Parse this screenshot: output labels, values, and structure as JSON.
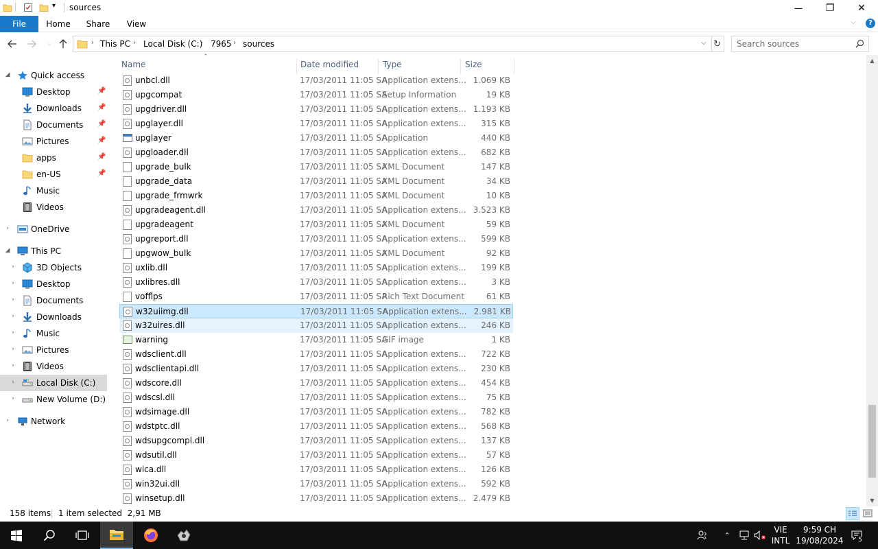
{
  "window": {
    "title": "sources",
    "controls": {
      "minimize": "—",
      "maximize": "❐",
      "close": "✕"
    }
  },
  "ribbon": {
    "tabs": [
      "File",
      "Home",
      "Share",
      "View"
    ]
  },
  "address": {
    "breadcrumbs": [
      "This PC",
      "Local Disk (C:)",
      "7965",
      "sources"
    ],
    "search_placeholder": "Search sources"
  },
  "nav_pane": {
    "quick_access": {
      "label": "Quick access",
      "items": [
        {
          "label": "Desktop",
          "icon": "desktop-icon",
          "pinned": true
        },
        {
          "label": "Downloads",
          "icon": "downloads-icon",
          "pinned": true
        },
        {
          "label": "Documents",
          "icon": "documents-icon",
          "pinned": true
        },
        {
          "label": "Pictures",
          "icon": "pictures-icon",
          "pinned": true
        },
        {
          "label": "apps",
          "icon": "folder-icon",
          "pinned": true
        },
        {
          "label": "en-US",
          "icon": "folder-icon",
          "pinned": true
        },
        {
          "label": "Music",
          "icon": "music-icon",
          "pinned": false
        },
        {
          "label": "Videos",
          "icon": "videos-icon",
          "pinned": false
        }
      ]
    },
    "onedrive": "OneDrive",
    "this_pc": {
      "label": "This PC",
      "items": [
        {
          "label": "3D Objects",
          "icon": "3d-objects-icon"
        },
        {
          "label": "Desktop",
          "icon": "desktop-icon"
        },
        {
          "label": "Documents",
          "icon": "documents-icon"
        },
        {
          "label": "Downloads",
          "icon": "downloads-icon"
        },
        {
          "label": "Music",
          "icon": "music-icon"
        },
        {
          "label": "Pictures",
          "icon": "pictures-icon"
        },
        {
          "label": "Videos",
          "icon": "videos-icon"
        },
        {
          "label": "Local Disk (C:)",
          "icon": "local-disk-icon",
          "selected": true
        },
        {
          "label": "New Volume (D:)",
          "icon": "drive-icon"
        }
      ]
    },
    "network": "Network"
  },
  "file_list": {
    "columns": [
      "Name",
      "Date modified",
      "Type",
      "Size"
    ],
    "rows": [
      {
        "name": "unbcl.dll",
        "date": "17/03/2011 11:05 SA",
        "type": "Application extens...",
        "size": "1.069 KB",
        "icon": "dll"
      },
      {
        "name": "upgcompat",
        "date": "17/03/2011 11:05 SA",
        "type": "Setup Information",
        "size": "19 KB",
        "icon": "inf"
      },
      {
        "name": "upgdriver.dll",
        "date": "17/03/2011 11:05 SA",
        "type": "Application extens...",
        "size": "1.193 KB",
        "icon": "dll"
      },
      {
        "name": "upglayer.dll",
        "date": "17/03/2011 11:05 SA",
        "type": "Application extens...",
        "size": "315 KB",
        "icon": "dll"
      },
      {
        "name": "upglayer",
        "date": "17/03/2011 11:05 SA",
        "type": "Application",
        "size": "440 KB",
        "icon": "app"
      },
      {
        "name": "upgloader.dll",
        "date": "17/03/2011 11:05 SA",
        "type": "Application extens...",
        "size": "682 KB",
        "icon": "dll"
      },
      {
        "name": "upgrade_bulk",
        "date": "17/03/2011 11:05 SA",
        "type": "XML Document",
        "size": "147 KB",
        "icon": "xml"
      },
      {
        "name": "upgrade_data",
        "date": "17/03/2011 11:05 SA",
        "type": "XML Document",
        "size": "34 KB",
        "icon": "xml"
      },
      {
        "name": "upgrade_frmwrk",
        "date": "17/03/2011 11:05 SA",
        "type": "XML Document",
        "size": "10 KB",
        "icon": "xml"
      },
      {
        "name": "upgradeagent.dll",
        "date": "17/03/2011 11:05 SA",
        "type": "Application extens...",
        "size": "3.523 KB",
        "icon": "dll"
      },
      {
        "name": "upgradeagent",
        "date": "17/03/2011 11:05 SA",
        "type": "XML Document",
        "size": "59 KB",
        "icon": "xml"
      },
      {
        "name": "upgreport.dll",
        "date": "17/03/2011 11:05 SA",
        "type": "Application extens...",
        "size": "599 KB",
        "icon": "dll"
      },
      {
        "name": "upgwow_bulk",
        "date": "17/03/2011 11:05 SA",
        "type": "XML Document",
        "size": "92 KB",
        "icon": "xml"
      },
      {
        "name": "uxlib.dll",
        "date": "17/03/2011 11:05 SA",
        "type": "Application extens...",
        "size": "199 KB",
        "icon": "dll"
      },
      {
        "name": "uxlibres.dll",
        "date": "17/03/2011 11:05 SA",
        "type": "Application extens...",
        "size": "3 KB",
        "icon": "dll"
      },
      {
        "name": "vofflps",
        "date": "17/03/2011 11:05 SA",
        "type": "Rich Text Document",
        "size": "61 KB",
        "icon": "rtf"
      },
      {
        "name": "w32uiimg.dll",
        "date": "17/03/2011 11:05 SA",
        "type": "Application extens...",
        "size": "2.981 KB",
        "icon": "dll",
        "selected": true
      },
      {
        "name": "w32uires.dll",
        "date": "17/03/2011 11:05 SA",
        "type": "Application extens...",
        "size": "246 KB",
        "icon": "dll",
        "hovered": true
      },
      {
        "name": "warning",
        "date": "17/03/2011 11:05 SA",
        "type": "GIF image",
        "size": "1 KB",
        "icon": "gif"
      },
      {
        "name": "wdsclient.dll",
        "date": "17/03/2011 11:05 SA",
        "type": "Application extens...",
        "size": "722 KB",
        "icon": "dll"
      },
      {
        "name": "wdsclientapi.dll",
        "date": "17/03/2011 11:05 SA",
        "type": "Application extens...",
        "size": "230 KB",
        "icon": "dll"
      },
      {
        "name": "wdscore.dll",
        "date": "17/03/2011 11:05 SA",
        "type": "Application extens...",
        "size": "454 KB",
        "icon": "dll"
      },
      {
        "name": "wdscsl.dll",
        "date": "17/03/2011 11:05 SA",
        "type": "Application extens...",
        "size": "75 KB",
        "icon": "dll"
      },
      {
        "name": "wdsimage.dll",
        "date": "17/03/2011 11:05 SA",
        "type": "Application extens...",
        "size": "782 KB",
        "icon": "dll"
      },
      {
        "name": "wdstptc.dll",
        "date": "17/03/2011 11:05 SA",
        "type": "Application extens...",
        "size": "568 KB",
        "icon": "dll"
      },
      {
        "name": "wdsupgcompl.dll",
        "date": "17/03/2011 11:05 SA",
        "type": "Application extens...",
        "size": "137 KB",
        "icon": "dll"
      },
      {
        "name": "wdsutil.dll",
        "date": "17/03/2011 11:05 SA",
        "type": "Application extens...",
        "size": "57 KB",
        "icon": "dll"
      },
      {
        "name": "wica.dll",
        "date": "17/03/2011 11:05 SA",
        "type": "Application extens...",
        "size": "126 KB",
        "icon": "dll"
      },
      {
        "name": "win32ui.dll",
        "date": "17/03/2011 11:05 SA",
        "type": "Application extens...",
        "size": "592 KB",
        "icon": "dll"
      },
      {
        "name": "winsetup.dll",
        "date": "17/03/2011 11:05 SA",
        "type": "Application extens...",
        "size": "2.479 KB",
        "icon": "dll"
      }
    ]
  },
  "scrollbar": {
    "thumb_start_fraction": 0.79,
    "thumb_end_fraction": 0.96
  },
  "status": {
    "item_count": "158 items",
    "selection": "1 item selected  2,91 MB"
  },
  "taskbar": {
    "language_top": "VIE",
    "language_bottom": "INTL",
    "time": "9:59 CH",
    "date": "19/08/2024",
    "notification_count": "5"
  },
  "colors": {
    "accent": "#1979ca",
    "selection": "#cce8ff",
    "selection_border": "#99d1ff",
    "header_text": "#4c607a",
    "taskbar": "#101010"
  }
}
